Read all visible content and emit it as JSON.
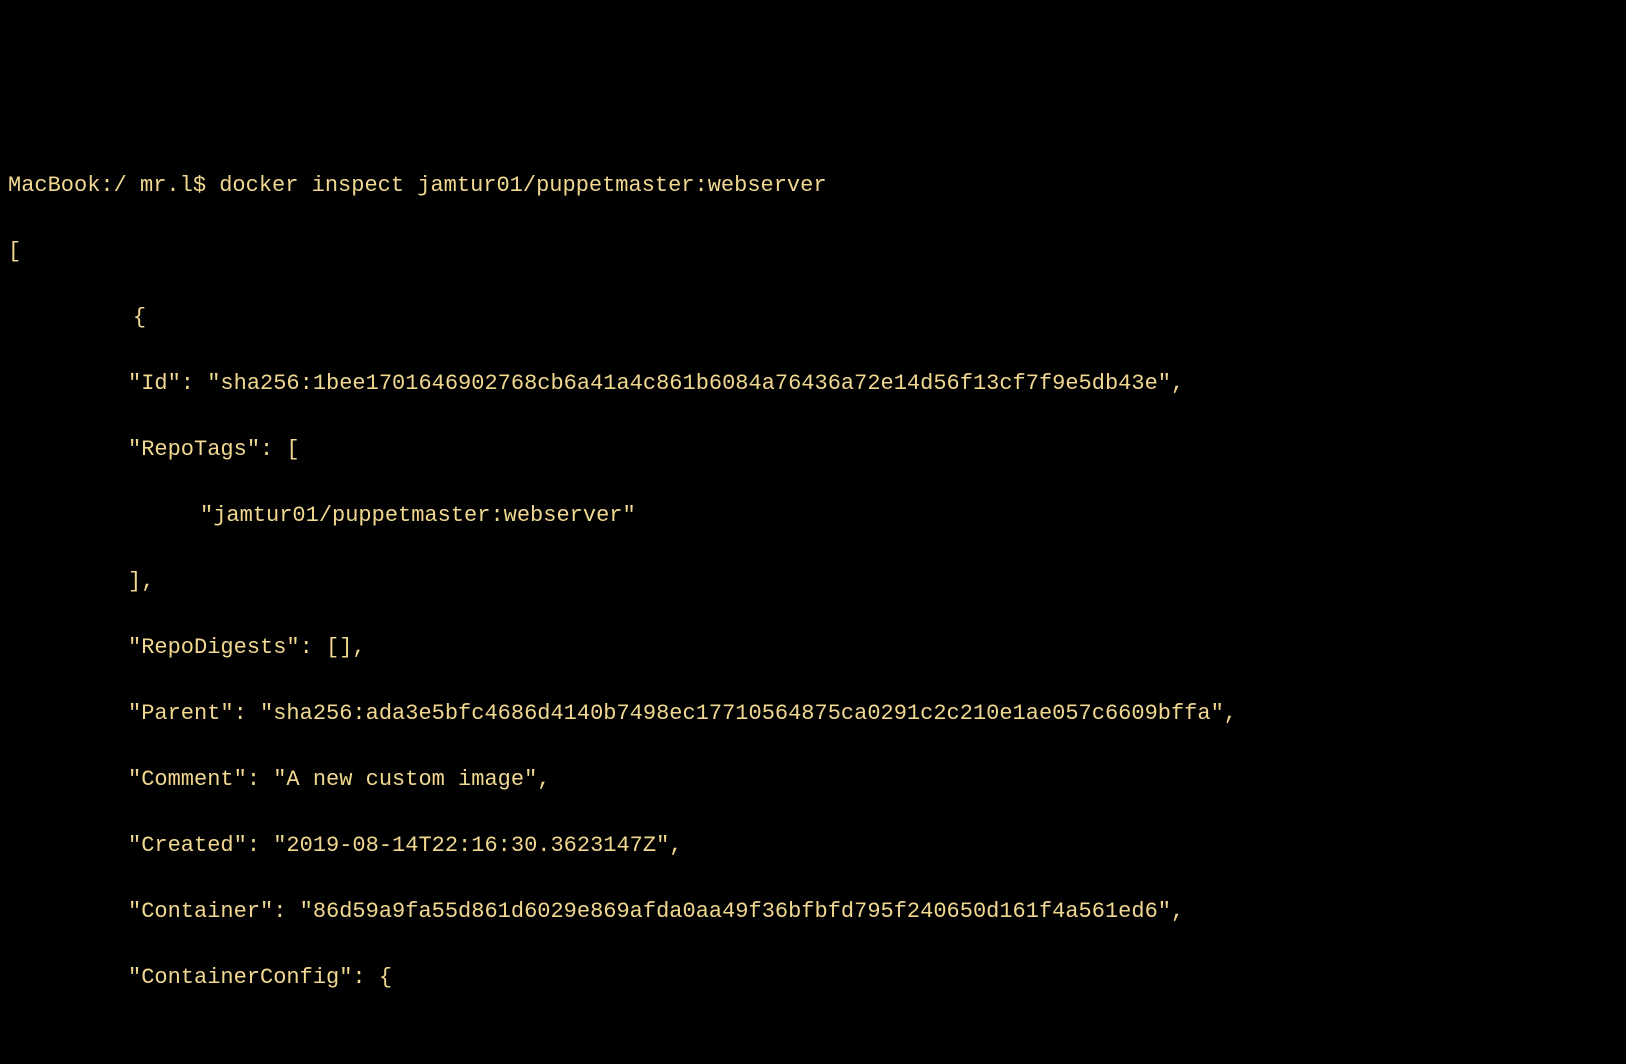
{
  "terminal": {
    "prompt": "MacBook:/ mr.l$ ",
    "command": "docker inspect jamtur01/puppetmaster:webserver",
    "output": {
      "open_bracket": "[",
      "open_brace": "{",
      "lines": [
        "\"Id\": \"sha256:1bee1701646902768cb6a41a4c861b6084a76436a72e14d56f13cf7f9e5db43e\",",
        "\"RepoTags\": [",
        "\"jamtur01/puppetmaster:webserver\"",
        "],",
        "\"RepoDigests\": [],",
        "\"Parent\": \"sha256:ada3e5bfc4686d4140b7498ec17710564875ca0291c2c210e1ae057c6609bffa\",",
        "\"Comment\": \"A new custom image\",",
        "\"Created\": \"2019-08-14T22:16:30.3623147Z\",",
        "\"Container\": \"86d59a9fa55d861d6029e869afda0aa49f36bfbfd795f240650d161f4a561ed6\",",
        "\"ContainerConfig\": {"
      ]
    }
  }
}
